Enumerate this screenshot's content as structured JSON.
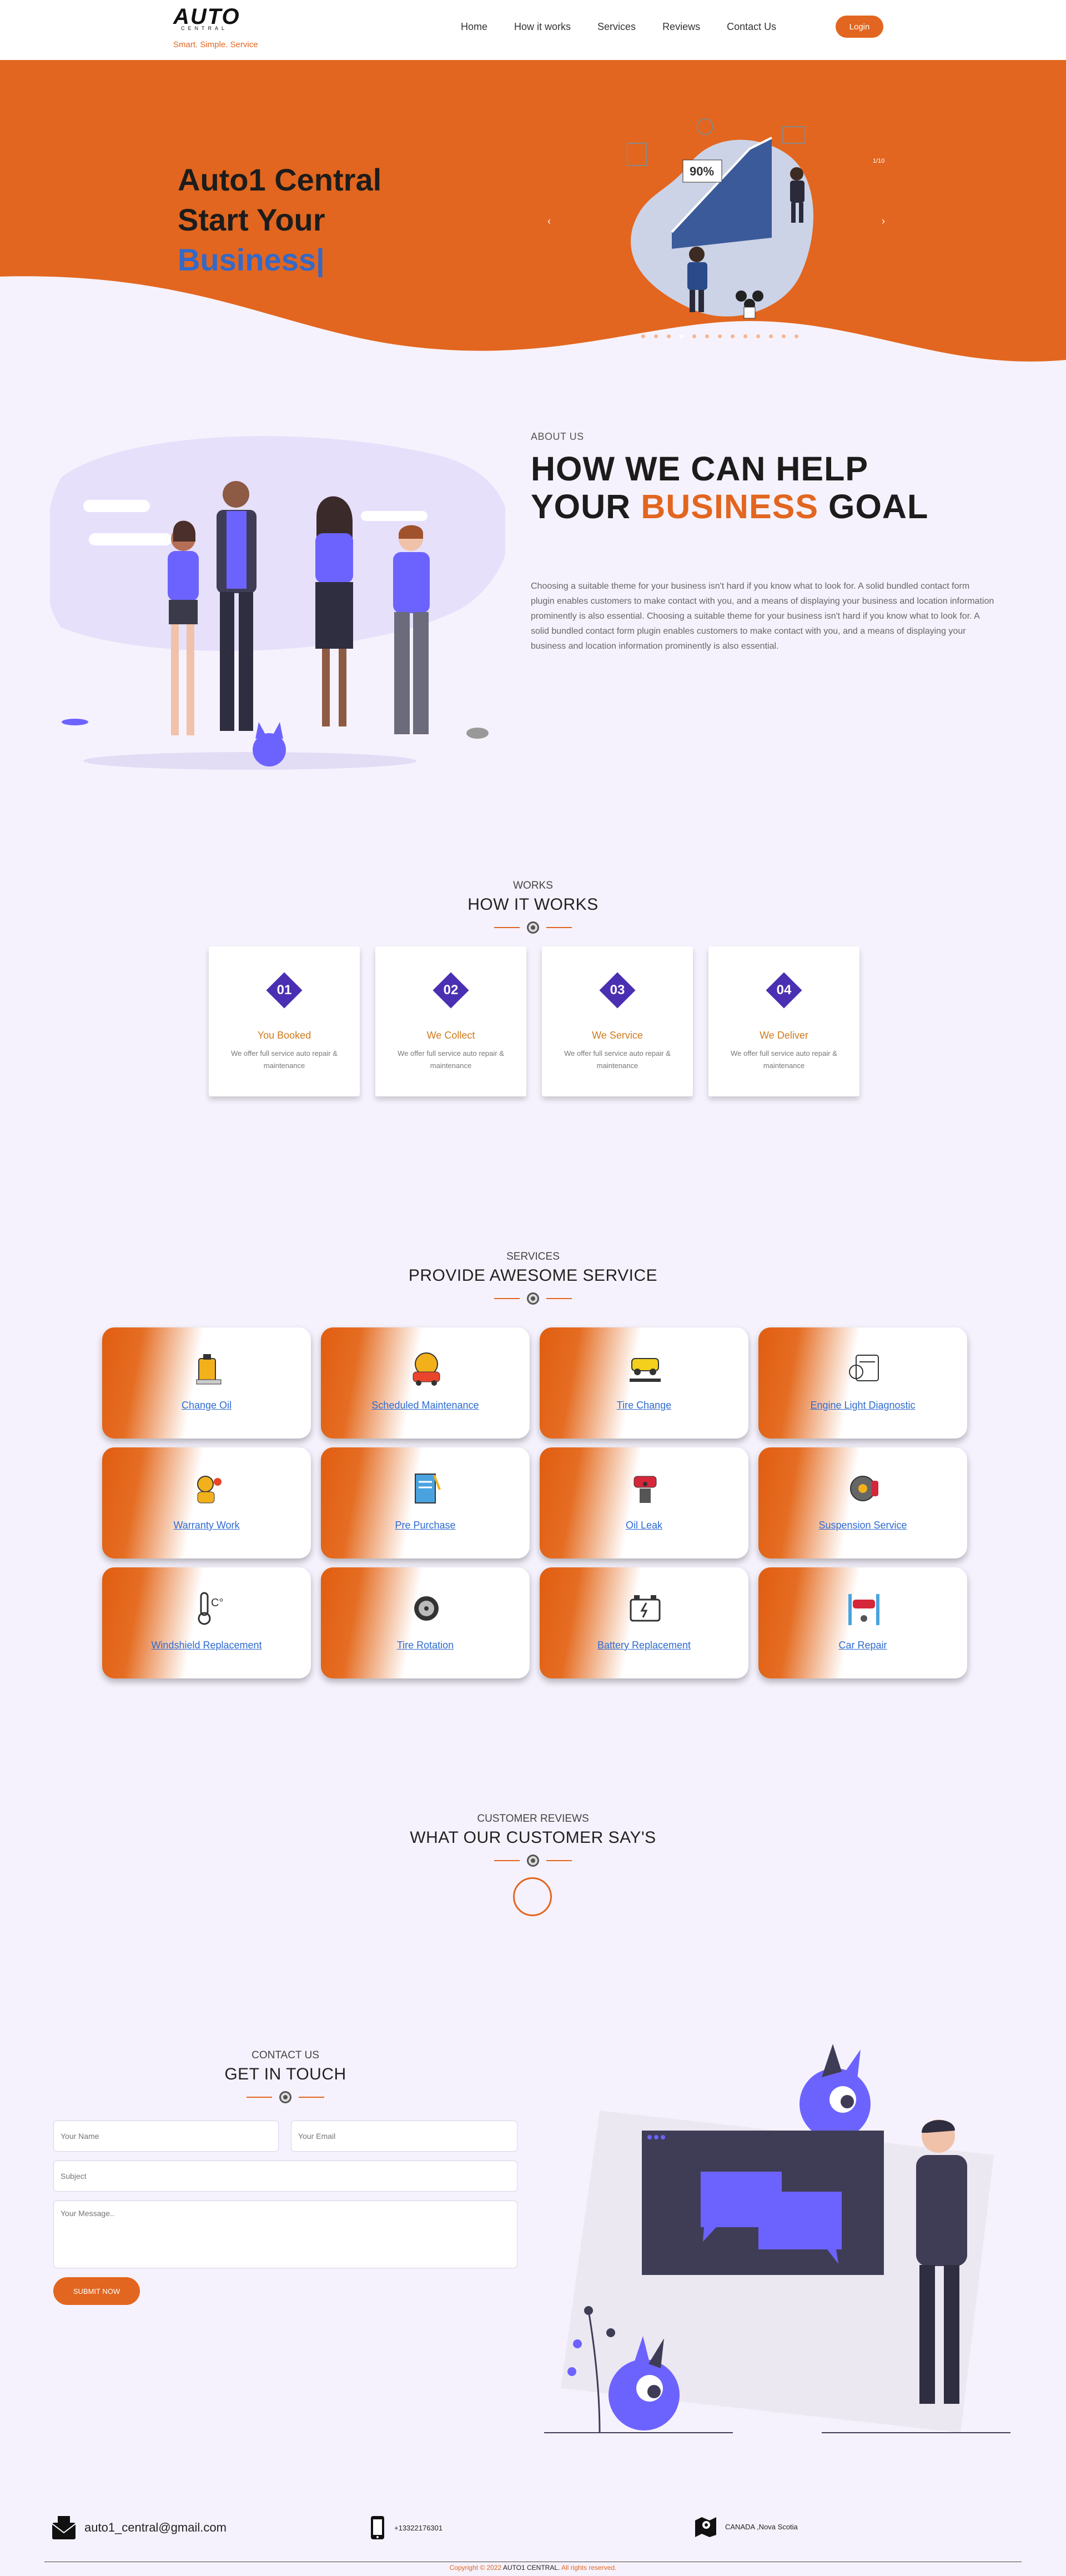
{
  "colors": {
    "accent": "#e2661f",
    "purple": "#4a2fb3",
    "link": "#2f6bd1",
    "bg": "#f6f2fd"
  },
  "brand": {
    "logo_word": "AUTO",
    "logo_sub": "CENTRAL",
    "tagline": "Smart. Simple. Service"
  },
  "nav": {
    "items": [
      "Home",
      "How it works",
      "Services",
      "Reviews",
      "Contact Us"
    ],
    "login": "Login"
  },
  "hero": {
    "line1": "Auto1 Central",
    "line2": "Start Your",
    "line3": "Business|",
    "slide_counter": "1/10",
    "prev_icon": "chevron-left-icon",
    "next_icon": "chevron-right-icon",
    "slide_count": 13,
    "active_slide": 4,
    "art_text": "90%"
  },
  "about": {
    "eyebrow": "ABOUT US",
    "title_line1": "HOW WE CAN HELP",
    "title_line2_pre": "YOUR ",
    "title_line2_accent": "BUSINESS",
    "title_line2_post": " GOAL",
    "text": "Choosing a suitable theme for your business isn't hard if you know what to look for. A solid bundled contact form plugin enables customers to make contact with you, and a means of displaying your business and location information prominently is also essential. Choosing a suitable theme for your business isn't hard if you know what to look for. A solid bundled contact form plugin enables customers to make contact with you, and a means of displaying your business and location information prominently is also essential."
  },
  "works": {
    "eyebrow": "WORKS",
    "title": "HOW IT WORKS",
    "steps": [
      {
        "num": "01",
        "name": "You Booked",
        "desc": "We offer full service auto repair & maintenance"
      },
      {
        "num": "02",
        "name": "We Collect",
        "desc": "We offer full service auto repair & maintenance"
      },
      {
        "num": "03",
        "name": "We Service",
        "desc": "We offer full service auto repair & maintenance"
      },
      {
        "num": "04",
        "name": "We Deliver",
        "desc": "We offer full service auto repair & maintenance"
      }
    ]
  },
  "services": {
    "eyebrow": "SERVICES",
    "title": "PROVIDE AWESOME SERVICE",
    "items": [
      {
        "label": "Change Oil",
        "icon": "oil-can-icon"
      },
      {
        "label": "Scheduled Maintenance",
        "icon": "car-wrench-icon"
      },
      {
        "label": "Tire Change",
        "icon": "car-lift-icon"
      },
      {
        "label": "Engine Light Diagnostic",
        "icon": "engine-check-icon"
      },
      {
        "label": "Warranty Work",
        "icon": "mechanic-icon"
      },
      {
        "label": "Pre Purchase",
        "icon": "checklist-icon"
      },
      {
        "label": "Oil Leak",
        "icon": "oil-leak-icon"
      },
      {
        "label": "Suspension Service",
        "icon": "brake-disc-icon"
      },
      {
        "label": "Windshield Replacement",
        "icon": "thermometer-icon"
      },
      {
        "label": "Tire Rotation",
        "icon": "wheel-icon"
      },
      {
        "label": "Battery Replacement",
        "icon": "battery-icon"
      },
      {
        "label": "Car Repair",
        "icon": "car-jack-icon"
      }
    ]
  },
  "reviews": {
    "eyebrow": "CUSTOMER REVIEWS",
    "title": "WHAT OUR CUSTOMER SAY'S"
  },
  "contact": {
    "eyebrow": "CONTACT US",
    "title": "GET IN TOUCH",
    "name_placeholder": "Your Name",
    "email_placeholder": "Your Email",
    "subject_placeholder": "Subject",
    "message_placeholder": "Your Message..",
    "submit": "SUBMIT NOW"
  },
  "footer": {
    "email": "auto1_central@gmail.com",
    "phone": "+13322176301",
    "location": "CANADA ,Nova Scotia",
    "copy_pre": "Copyright © 2022 ",
    "copy_brand": "AUTO1 CENTRAL.",
    "copy_post": " All rights reserved."
  }
}
